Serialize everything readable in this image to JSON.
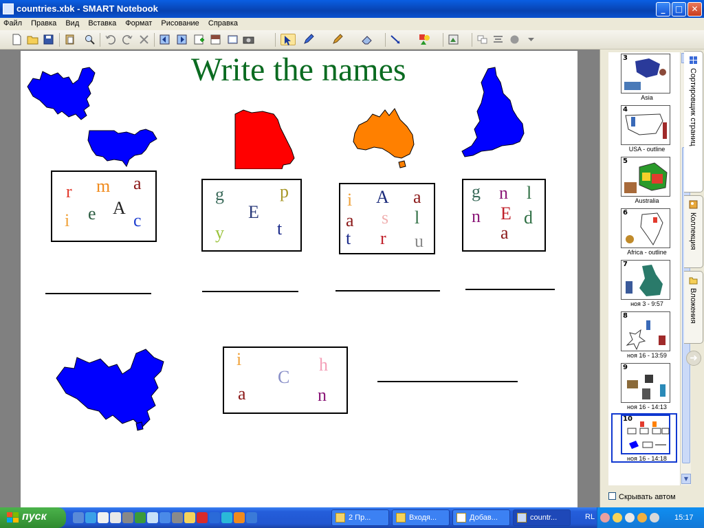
{
  "window": {
    "title": "countries.xbk - SMART Notebook",
    "min": "_",
    "max": "□",
    "close": "✕"
  },
  "menu": [
    "Файл",
    "Правка",
    "Вид",
    "Вставка",
    "Формат",
    "Рисование",
    "Справка"
  ],
  "toolbar_icons": [
    "new-icon",
    "open-icon",
    "save-icon",
    "paste-icon",
    "zoom-icon",
    "undo-icon",
    "redo-icon",
    "delete-icon",
    "prev-page-icon",
    "next-page-icon",
    "add-page-icon",
    "screen-shade-icon",
    "full-screen-icon",
    "camera-icon",
    "select-icon",
    "pen-icon",
    "creative-pen-icon",
    "eraser-icon",
    "line-icon",
    "shapes-icon",
    "fill-icon",
    "properties-icon",
    "more-icon"
  ],
  "page": {
    "title": "Write the names",
    "title_color": "#0b6b21",
    "box1": {
      "letters": [
        "r",
        "m",
        "a",
        "A",
        "i",
        "e",
        "c"
      ],
      "colors": [
        "#e23b2e",
        "#f08a1c",
        "#8b1818",
        "#222222",
        "#f0a23a",
        "#2f5f44",
        "#2040d0"
      ]
    },
    "box2": {
      "letters": [
        "g",
        "p",
        "E",
        "t",
        "y"
      ],
      "colors": [
        "#3a6a5a",
        "#a8982a",
        "#2a3a7a",
        "#1a2a8a",
        "#9ac23a"
      ]
    },
    "box3": {
      "letters": [
        "i",
        "A",
        "a",
        "a",
        "s",
        "l",
        "t",
        "r",
        "u"
      ],
      "colors": [
        "#f0a23a",
        "#1a2a7a",
        "#8b1818",
        "#8b1818",
        "#f0b0b0",
        "#2f6f44",
        "#1a2a8a",
        "#c0202a",
        "#8a8a8a"
      ]
    },
    "box4": {
      "letters": [
        "g",
        "n",
        "l",
        "n",
        "E",
        "d",
        "a"
      ],
      "colors": [
        "#3a6a5a",
        "#8b1878",
        "#2f6f44",
        "#8b1878",
        "#c0202a",
        "#2f6f44",
        "#8b1818"
      ]
    },
    "box5": {
      "letters": [
        "i",
        "h",
        "C",
        "a",
        "n"
      ],
      "colors": [
        "#f0a23a",
        "#f4a0b8",
        "#8a90c8",
        "#8b1818",
        "#8b1878"
      ]
    }
  },
  "sorter": {
    "pages": [
      {
        "num": "3",
        "caption": "Asia"
      },
      {
        "num": "4",
        "caption": "USA - outline"
      },
      {
        "num": "5",
        "caption": "Australia"
      },
      {
        "num": "6",
        "caption": "Africa - outline"
      },
      {
        "num": "7",
        "caption": "ноя 3 - 9:57"
      },
      {
        "num": "8",
        "caption": "ноя 16 - 13:59"
      },
      {
        "num": "9",
        "caption": "ноя 16 - 14:13"
      },
      {
        "num": "10",
        "caption": "ноя 16 - 14:18"
      }
    ],
    "tabs": [
      "Сортировщик страниц",
      "Коллекция",
      "Вложения"
    ],
    "hide_auto_label": "Скрывать автом"
  },
  "taskbar": {
    "start": "пуск",
    "tasks": [
      "2 Пр...",
      "Входя...",
      "Добав...",
      "countr..."
    ],
    "lang": "RL",
    "clock": "15:17"
  }
}
